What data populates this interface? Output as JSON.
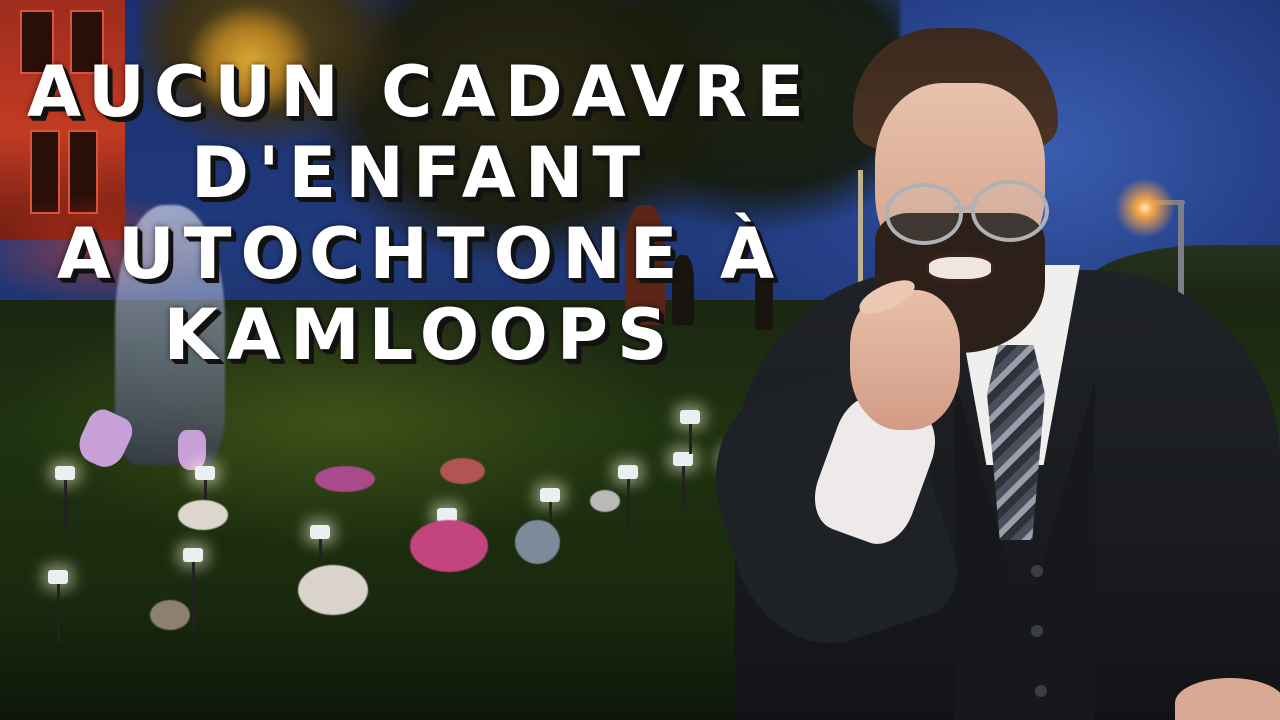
{
  "headline": {
    "lines": [
      "AUCUN CADAVRE",
      "D'ENFANT",
      "AUTOCHTONE À",
      "KAMLOOPS"
    ],
    "color": "#ffffff",
    "shadow_color": "#111111"
  },
  "scene": {
    "background": "memorial-vigil-photo",
    "presenter": "bearded-man-in-suit-pointing"
  }
}
